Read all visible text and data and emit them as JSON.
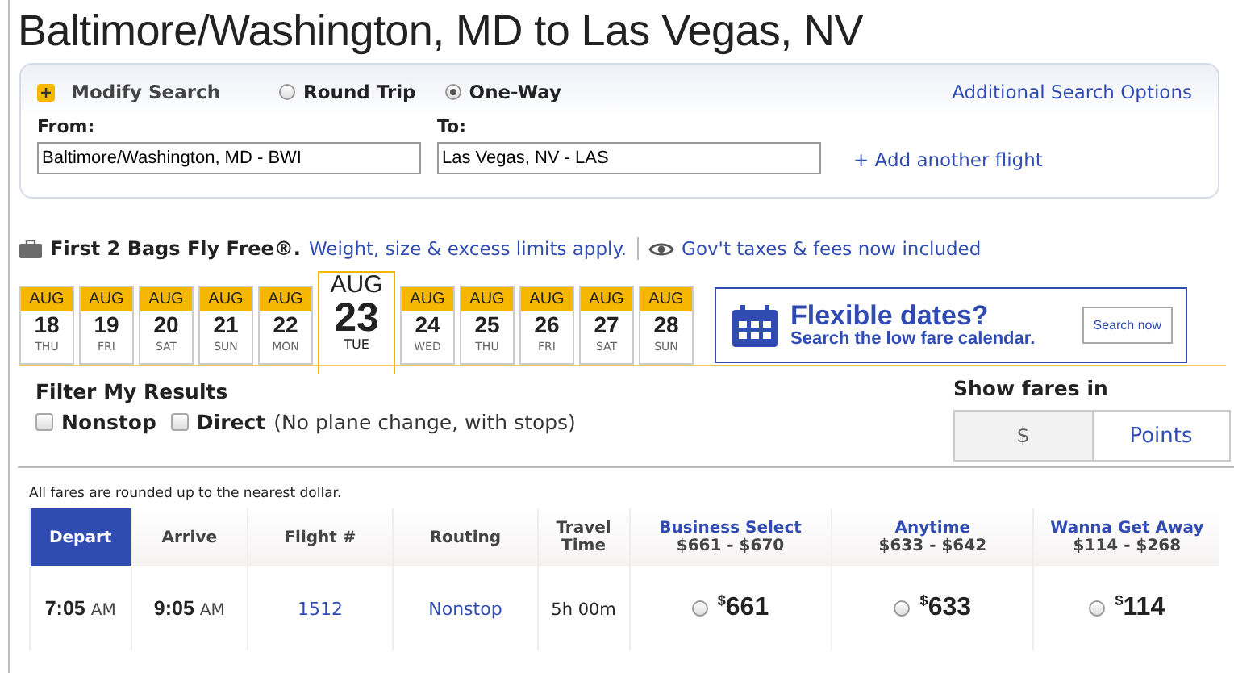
{
  "title": "Baltimore/Washington, MD to Las Vegas, NV",
  "search": {
    "modify_label": "Modify Search",
    "trip_types": [
      {
        "label": "Round Trip",
        "selected": false
      },
      {
        "label": "One-Way",
        "selected": true
      }
    ],
    "additional_link": "Additional Search Options",
    "from": {
      "label": "From:",
      "value": "Baltimore/Washington, MD - BWI"
    },
    "to": {
      "label": "To:",
      "value": "Las Vegas, NV - LAS"
    },
    "add_flight": "+ Add another flight"
  },
  "notice": {
    "bags": "First 2 Bags Fly Free®.",
    "bags_link": "Weight, size & excess limits apply.",
    "taxes_link": "Gov't taxes & fees now included"
  },
  "days": [
    {
      "month": "AUG",
      "day": "18",
      "weekday": "THU",
      "selected": false
    },
    {
      "month": "AUG",
      "day": "19",
      "weekday": "FRI",
      "selected": false
    },
    {
      "month": "AUG",
      "day": "20",
      "weekday": "SAT",
      "selected": false
    },
    {
      "month": "AUG",
      "day": "21",
      "weekday": "SUN",
      "selected": false
    },
    {
      "month": "AUG",
      "day": "22",
      "weekday": "MON",
      "selected": false
    },
    {
      "month": "AUG",
      "day": "23",
      "weekday": "TUE",
      "selected": true
    },
    {
      "month": "AUG",
      "day": "24",
      "weekday": "WED",
      "selected": false
    },
    {
      "month": "AUG",
      "day": "25",
      "weekday": "THU",
      "selected": false
    },
    {
      "month": "AUG",
      "day": "26",
      "weekday": "FRI",
      "selected": false
    },
    {
      "month": "AUG",
      "day": "27",
      "weekday": "SAT",
      "selected": false
    },
    {
      "month": "AUG",
      "day": "28",
      "weekday": "SUN",
      "selected": false
    }
  ],
  "promo": {
    "heading": "Flexible dates?",
    "subheading": "Search the low fare calendar.",
    "button": "Search now"
  },
  "filters": {
    "title": "Filter My Results",
    "options": [
      {
        "label": "Nonstop",
        "checked": false
      },
      {
        "label": "Direct",
        "note": "(No plane change, with stops)",
        "checked": false
      }
    ]
  },
  "fare_display": {
    "title": "Show fares in",
    "options": [
      {
        "label": "$",
        "selected": true
      },
      {
        "label": "Points",
        "selected": false
      }
    ]
  },
  "rounding_note": "All fares are rounded up to the nearest dollar.",
  "table": {
    "columns": [
      {
        "label": "Depart",
        "kind": "plain",
        "selected": true
      },
      {
        "label": "Arrive",
        "kind": "plain",
        "selected": false
      },
      {
        "label": "Flight #",
        "kind": "plain",
        "selected": false
      },
      {
        "label": "Routing",
        "kind": "plain",
        "selected": false
      },
      {
        "label": "Travel Time",
        "kind": "plain",
        "selected": false
      },
      {
        "label": "Business Select",
        "range": "$661 - $670",
        "kind": "fare",
        "selected": false
      },
      {
        "label": "Anytime",
        "range": "$633 - $642",
        "kind": "fare",
        "selected": false
      },
      {
        "label": "Wanna Get Away",
        "range": "$114 - $268",
        "kind": "fare",
        "selected": false
      }
    ],
    "rows": [
      {
        "depart": {
          "time": "7:05",
          "period": "AM"
        },
        "arrive": {
          "time": "9:05",
          "period": "AM"
        },
        "flight": "1512",
        "routing": "Nonstop",
        "travel_time": "5h 00m",
        "fares": [
          {
            "currency": "$",
            "amount": "661",
            "selected": false
          },
          {
            "currency": "$",
            "amount": "633",
            "selected": false
          },
          {
            "currency": "$",
            "amount": "114",
            "selected": false
          }
        ]
      }
    ]
  }
}
